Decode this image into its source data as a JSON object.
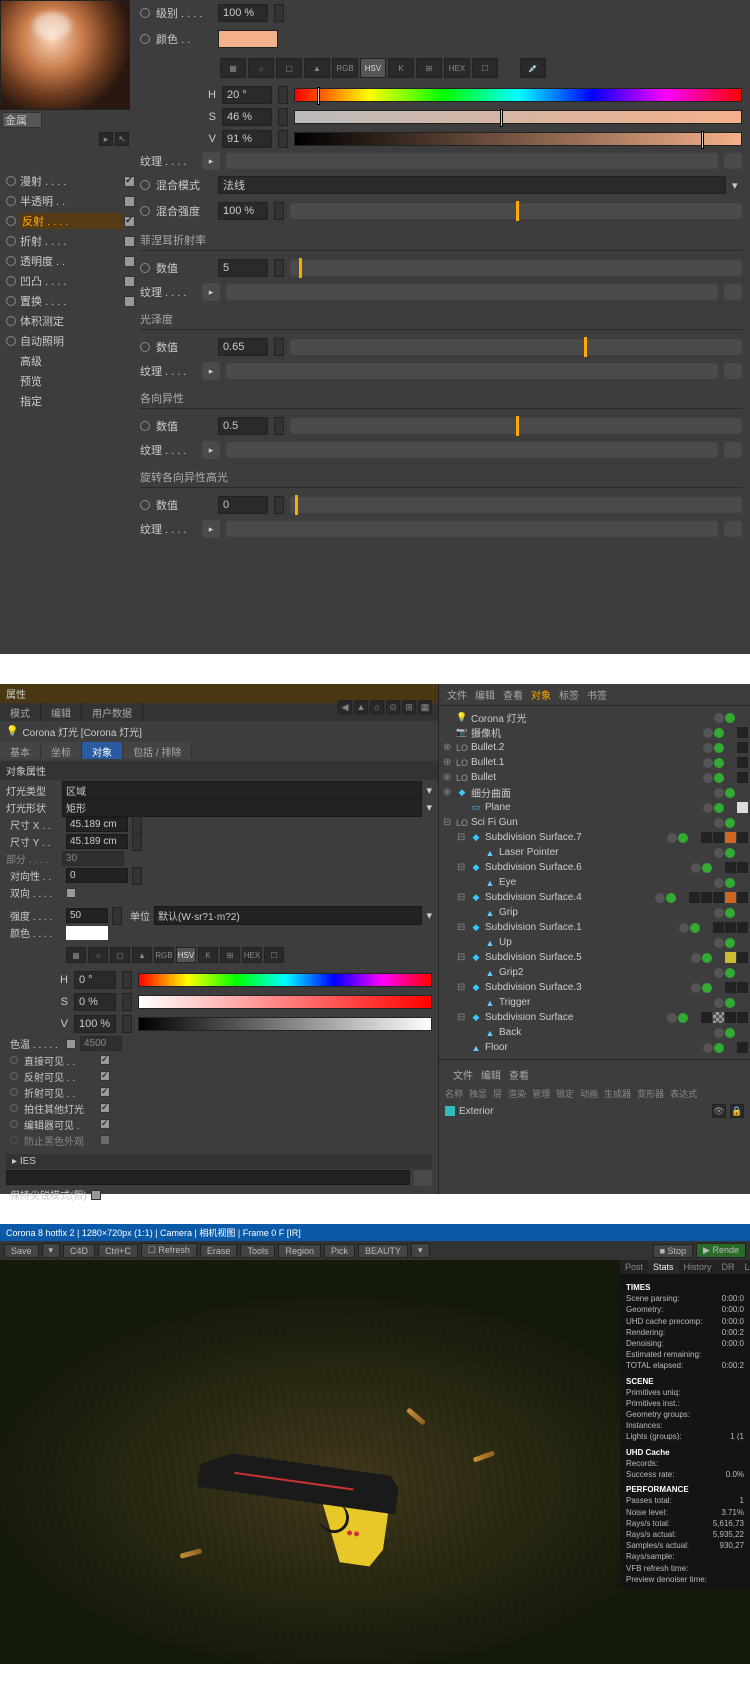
{
  "panel1": {
    "material_name": "金属",
    "channels": [
      {
        "label": "漫射 . . . .",
        "checked": true,
        "radio": true
      },
      {
        "label": "半透明 . .",
        "checked": false,
        "radio": true
      },
      {
        "label": "反射 . . . .",
        "checked": true,
        "radio": true,
        "active": true
      },
      {
        "label": "折射 . . . .",
        "checked": false,
        "radio": true
      },
      {
        "label": "透明度 . .",
        "checked": false,
        "radio": true
      },
      {
        "label": "凹凸 . . . .",
        "checked": false,
        "radio": true
      },
      {
        "label": "置换 . . . .",
        "checked": false,
        "radio": true
      },
      {
        "label": "体积测定",
        "checked": false,
        "radio": true,
        "nocheck": true
      },
      {
        "label": "自动照明",
        "checked": false,
        "radio": true,
        "nocheck": true
      },
      {
        "label": "高级",
        "radio": false
      },
      {
        "label": "预览",
        "radio": false
      },
      {
        "label": "指定",
        "radio": false
      }
    ],
    "level_label": "级别 . . . .",
    "level_val": "100 %",
    "color_label": "颜色 . .",
    "modes": [
      "▦",
      "☼",
      "▢",
      "▲",
      "RGB",
      "HSV",
      "K",
      "⊞",
      "HEX",
      "☐"
    ],
    "hsv": [
      {
        "k": "H",
        "v": "20 °",
        "pos": "5%"
      },
      {
        "k": "S",
        "v": "46 %",
        "pos": "46%"
      },
      {
        "k": "V",
        "v": "91 %",
        "pos": "91%"
      }
    ],
    "tex_label": "纹理 . . . .",
    "blend_mode_label": "混合模式",
    "blend_mode_val": "法线",
    "blend_str_label": "混合强度",
    "blend_str_val": "100 %",
    "sec_fresnel": "菲涅耳折射率",
    "sec_gloss": "光泽度",
    "sec_aniso": "各向异性",
    "sec_rot": "旋转各向异性高光",
    "numlabel": "数值",
    "fresnel_val": "5",
    "fresnel_pos": "2%",
    "gloss_val": "0.65",
    "gloss_pos": "65%",
    "aniso_val": "0.5",
    "aniso_pos": "50%",
    "rot_val": "0",
    "rot_pos": "1%"
  },
  "panel2": {
    "attr_title": "属性",
    "menu": [
      "模式",
      "编辑",
      "用户数据"
    ],
    "icons": [
      "◀",
      "▲",
      "⌂",
      "⊙",
      "⊞",
      "▦"
    ],
    "obj_name": "Corona 灯光 [Corona 灯光]",
    "tabs": [
      "基本",
      "坐标",
      "对象",
      "包括 / 排除"
    ],
    "tabs_active": 2,
    "sec_obj": "对象属性",
    "light_type_label": "灯光类型",
    "light_type": "区域",
    "light_shape_label": "灯光形状",
    "light_shape": "矩形",
    "sizex_label": "尺寸 X . .",
    "sizex": "45.189 cm",
    "sizey_label": "尺寸 Y . .",
    "sizey": "45.189 cm",
    "seg_label": "部分 . . . .",
    "seg": "30",
    "sym_label": "对向性 . .",
    "sym": "0",
    "bidir_label": "双向 . . . .",
    "intensity_label": "强度 . . . .",
    "intensity": "50",
    "unit_label": "单位",
    "unit": "默认(W·sr?1·m?2)",
    "color2_label": "颜色 . . . .",
    "hsv2": [
      {
        "k": "H",
        "v": "0 °"
      },
      {
        "k": "S",
        "v": "0 %"
      },
      {
        "k": "V",
        "v": "100 %"
      }
    ],
    "temp_label": "色温 . . . . .",
    "temp": "4500",
    "checks": [
      {
        "label": "直接可见 . .",
        "on": true
      },
      {
        "label": "反射可见 . .",
        "on": true
      },
      {
        "label": "折射可见 . .",
        "on": true
      },
      {
        "label": "拍住其他灯光",
        "on": true
      },
      {
        "label": "编辑器可见 .",
        "on": true
      },
      {
        "label": "防止黑色外观",
        "on": false,
        "disabled": true
      }
    ],
    "ies_label": "IES",
    "keep_sharp": "保持尖锐模式(假)",
    "om_tabs_top": [
      "文件",
      "编辑",
      "查看",
      "对象",
      "标签",
      "书签"
    ],
    "om_tabs_active": 3,
    "tree": [
      {
        "i": 0,
        "icon": "💡",
        "name": "Corona 灯光",
        "c": "#f84",
        "tags": [
          "grey",
          "green"
        ]
      },
      {
        "i": 0,
        "icon": "📷",
        "name": "摄像机",
        "c": "#ccc",
        "tags": [
          "grey",
          "green",
          "dark"
        ]
      },
      {
        "i": 0,
        "icon": "LO",
        "name": "Bullet.2",
        "arrow": "⊕",
        "tags": [
          "grey",
          "green",
          "dark"
        ]
      },
      {
        "i": 0,
        "icon": "LO",
        "name": "Bullet.1",
        "arrow": "⊕",
        "tags": [
          "grey",
          "green",
          "dark"
        ]
      },
      {
        "i": 0,
        "icon": "LO",
        "name": "Bullet",
        "arrow": "⊕",
        "tags": [
          "grey",
          "green",
          "dark"
        ]
      },
      {
        "i": 0,
        "icon": "◆",
        "name": "细分曲面",
        "c": "#3cf",
        "arrow": "⊕",
        "tags": [
          "grey",
          "green"
        ]
      },
      {
        "i": 1,
        "icon": "▭",
        "name": "Plane",
        "c": "#3cf",
        "tags": [
          "grey",
          "green",
          "white"
        ]
      },
      {
        "i": 0,
        "icon": "LO",
        "name": "Sci Fi Gun",
        "arrow": "⊟",
        "tags": [
          "grey",
          "green"
        ]
      },
      {
        "i": 1,
        "icon": "◆",
        "name": "Subdivision Surface.7",
        "c": "#3cf",
        "arrow": "⊟",
        "tags": [
          "grey",
          "green",
          "dark",
          "dark",
          "orange",
          "dark"
        ]
      },
      {
        "i": 2,
        "icon": "▲",
        "name": "Laser Pointer",
        "c": "#6cf",
        "tags": [
          "grey",
          "green"
        ]
      },
      {
        "i": 1,
        "icon": "◆",
        "name": "Subdivision Surface.6",
        "c": "#3cf",
        "arrow": "⊟",
        "tags": [
          "grey",
          "green",
          "dark",
          "dark"
        ]
      },
      {
        "i": 2,
        "icon": "▲",
        "name": "Eye",
        "c": "#6cf",
        "tags": [
          "grey",
          "green"
        ]
      },
      {
        "i": 1,
        "icon": "◆",
        "name": "Subdivision Surface.4",
        "c": "#3cf",
        "arrow": "⊟",
        "tags": [
          "grey",
          "green",
          "dark",
          "dark",
          "dark",
          "orange",
          "dark"
        ]
      },
      {
        "i": 2,
        "icon": "▲",
        "name": "Grip",
        "c": "#6cf",
        "tags": [
          "grey",
          "green"
        ]
      },
      {
        "i": 1,
        "icon": "◆",
        "name": "Subdivision Surface.1",
        "c": "#3cf",
        "arrow": "⊟",
        "tags": [
          "grey",
          "green",
          "dark",
          "dark",
          "dark"
        ]
      },
      {
        "i": 2,
        "icon": "▲",
        "name": "Up",
        "c": "#6cf",
        "tags": [
          "grey",
          "green"
        ]
      },
      {
        "i": 1,
        "icon": "◆",
        "name": "Subdivision Surface.5",
        "c": "#3cf",
        "arrow": "⊟",
        "tags": [
          "grey",
          "green",
          "yellow",
          "dark"
        ]
      },
      {
        "i": 2,
        "icon": "▲",
        "name": "Grip2",
        "c": "#6cf",
        "tags": [
          "grey",
          "green"
        ]
      },
      {
        "i": 1,
        "icon": "◆",
        "name": "Subdivision Surface.3",
        "c": "#3cf",
        "arrow": "⊟",
        "tags": [
          "grey",
          "green",
          "dark",
          "dark"
        ]
      },
      {
        "i": 2,
        "icon": "▲",
        "name": "Trigger",
        "c": "#6cf",
        "tags": [
          "grey",
          "green"
        ]
      },
      {
        "i": 1,
        "icon": "◆",
        "name": "Subdivision Surface",
        "c": "#3cf",
        "arrow": "⊟",
        "tags": [
          "grey",
          "green",
          "dark",
          "check",
          "dark",
          "dark"
        ]
      },
      {
        "i": 2,
        "icon": "▲",
        "name": "Back",
        "c": "#6cf",
        "tags": [
          "grey",
          "green"
        ]
      },
      {
        "i": 1,
        "icon": "▲",
        "name": "Floor",
        "c": "#6cf",
        "tags": [
          "grey",
          "green",
          "dark"
        ]
      }
    ],
    "om_tabs_bot": [
      "文件",
      "编辑",
      "查看"
    ],
    "cat_labels": [
      "名称",
      "独显",
      "层",
      "渲染",
      "管理",
      "锁定",
      "动画",
      "生成器",
      "变形器",
      "表达式"
    ],
    "exterior": "Exterior"
  },
  "panel3": {
    "title": "Corona 8 hotfix 2 | 1280×720px (1:1) | Camera | 相机视图 | Frame 0 F [IR]",
    "toolbar": [
      "Save",
      "▾",
      "C4D",
      "Ctrl+C",
      "☐ Refresh",
      "Erase",
      "Tools",
      "Region",
      "Pick",
      "BEAUTY",
      "▾"
    ],
    "rtabs": [
      "Post",
      "Stats",
      "History",
      "DR",
      "LightM"
    ],
    "stop": "■ Stop",
    "render": "▶ Rende",
    "stats": {
      "TIMES": [
        [
          "Scene parsing:",
          "0:00:0"
        ],
        [
          "Geometry:",
          "0:00:0"
        ],
        [
          "UHD cache precomp:",
          "0:00:0"
        ],
        [
          "Rendering:",
          "0:00:2"
        ],
        [
          "Denoising:",
          "0:00:0"
        ],
        [
          "Estimated remaining:",
          ""
        ],
        [
          "TOTAL elapsed:",
          "0:00:2"
        ]
      ],
      "SCENE": [
        [
          "Primitives uniq:",
          ""
        ],
        [
          "Primitives inst.:",
          ""
        ],
        [
          "Geometry groups:",
          ""
        ],
        [
          "Instances:",
          ""
        ],
        [
          "Lights (groups):",
          "1 (1"
        ]
      ],
      "UHD Cache": [
        [
          "Records:",
          ""
        ],
        [
          "Success rate:",
          "0.0%"
        ]
      ],
      "PERFORMANCE": [
        [
          "Passes total:",
          "1"
        ],
        [
          "Noise level:",
          "3.71%"
        ],
        [
          "Rays/s total:",
          "5,616,73"
        ],
        [
          "Rays/s actual:",
          "5,935,22"
        ],
        [
          "Samples/s actual:",
          "930,27"
        ],
        [
          "Rays/sample:",
          ""
        ],
        [
          "VFB refresh time:",
          ""
        ],
        [
          "Preview denoiser time:",
          ""
        ]
      ]
    }
  }
}
